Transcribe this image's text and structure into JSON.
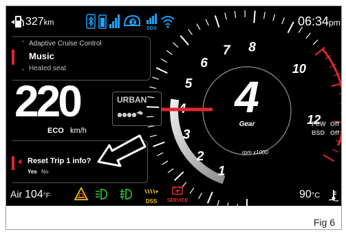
{
  "status": {
    "fuel_range_value": "327",
    "fuel_range_unit": "km",
    "time": "06:34",
    "time_suffix": "pm"
  },
  "menu": {
    "prev_item": "Adaptive Cruise Control",
    "current_item": "Music",
    "next_item": "Heated seat"
  },
  "speed": {
    "value": "220",
    "mode": "ECO",
    "unit": "km/h"
  },
  "riding_mode": {
    "label": "URBAN"
  },
  "gear": {
    "value": "4",
    "label": "Gear",
    "rpm_unit": "rpm x1000"
  },
  "tach_labels": [
    "1",
    "2",
    "3",
    "4",
    "5",
    "6",
    "7",
    "8",
    "10",
    "12"
  ],
  "rpm_level_fraction": 0.33,
  "assist": {
    "fcw_label": "FCW",
    "fcw_value": "Off",
    "bsd_label": "BSD",
    "bsd_value": "Off"
  },
  "prompt": {
    "question": "Reset Trip 1 info?",
    "yes": "Yes",
    "no": "No"
  },
  "bottom": {
    "air_label": "Air",
    "air_temp": "104",
    "air_unit": "°F",
    "dss_label": "DSS",
    "service_label": "SERVICE",
    "coolant_temp": "90",
    "coolant_unit": "°C"
  },
  "figure_caption": "Fig 6",
  "colors": {
    "background": "#000000",
    "accent_red": "#e0262f",
    "indicator_blue": "#1aa3ff",
    "indicator_green": "#2fd12f",
    "warning_yellow": "#f2c200",
    "service_red": "#e83030"
  },
  "icons": [
    "fuel-pump-icon",
    "bluetooth-icon",
    "phone-battery-icon",
    "signal-icon",
    "helmet-intercom-icon",
    "sos-signal-icon",
    "wifi-icon",
    "rider-icon",
    "traction-control-warning-icon",
    "low-beam-icon",
    "fog-light-icon",
    "dss-icon",
    "service-wrench-icon",
    "coolant-temperature-icon",
    "pointer-arrow-icon"
  ]
}
